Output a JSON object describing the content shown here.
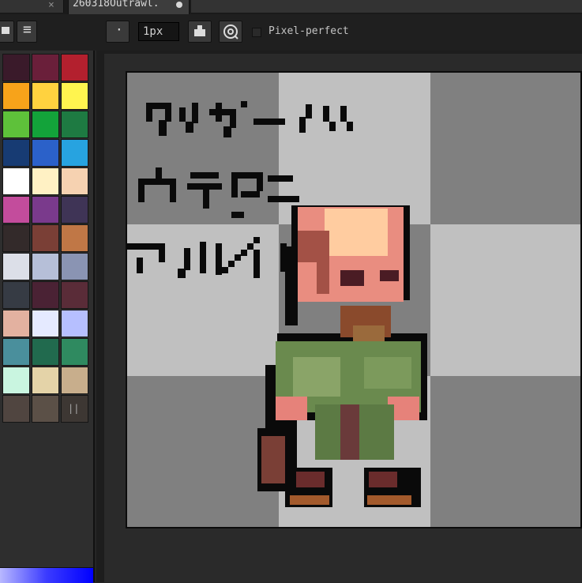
{
  "tabs": {
    "previous_close": "×",
    "active_title": "260318Outrawl.",
    "modified_indicator": "●"
  },
  "toolbar": {
    "brush_size": "1px",
    "pixel_perfect_label": "Pixel-perfect",
    "pixel_perfect_checked": false,
    "dot_label": "·",
    "hamburger": "≡"
  },
  "palette": {
    "colors": [
      "#3a1a2a",
      "#6a1f3a",
      "#b3202e",
      "#f7a31a",
      "#ffd23f",
      "#fff44f",
      "#5ec13a",
      "#13a33a",
      "#1e7a42",
      "#173b73",
      "#2b61c9",
      "#27a3e0",
      "#ffffff",
      "#fff1c4",
      "#f6d2b1",
      "#c34c9c",
      "#7a3a8c",
      "#3f3456",
      "#332a2a",
      "#7a3f36",
      "#c07746",
      "#dcdfe8",
      "#b6bfd8",
      "#8a94b3",
      "#363b44",
      "#4a2234",
      "#5a2c38",
      "#e3b1a0",
      "#e5eaff",
      "#b6bfff",
      "#4a8f9c",
      "#216a4e",
      "#2f8a60",
      "#c9f5e0",
      "#e4d3a8",
      "#c8ae8c",
      "#504540",
      "#5b5047",
      "#3d3733"
    ],
    "grip": "||"
  },
  "canvas": {
    "caption_lines": [
      "クリゲーハ",
      "カテダニ",
      "マルレイ"
    ]
  }
}
